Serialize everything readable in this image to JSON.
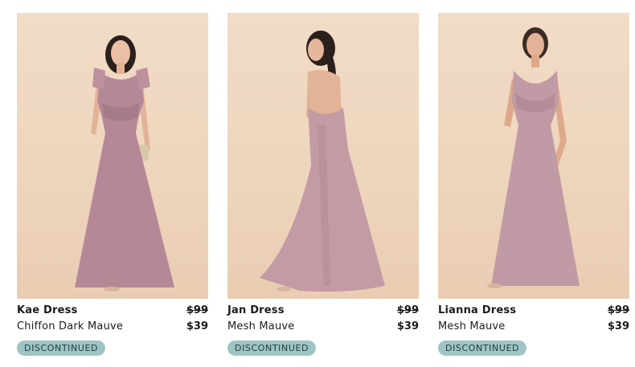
{
  "products": [
    {
      "name": "Kae Dress",
      "variant": "Chiffon Dark Mauve",
      "old_price": "$99",
      "price": "$39",
      "badge": "DISCONTINUED"
    },
    {
      "name": "Jan Dress",
      "variant": "Mesh Mauve",
      "old_price": "$99",
      "price": "$39",
      "badge": "DISCONTINUED"
    },
    {
      "name": "Lianna Dress",
      "variant": "Mesh Mauve",
      "old_price": "$99",
      "price": "$39",
      "badge": "DISCONTINUED"
    }
  ],
  "colors": {
    "photo_background": "#eed5bd",
    "dress_mauve": "#b88c99",
    "badge_background": "#9fc4c4"
  }
}
